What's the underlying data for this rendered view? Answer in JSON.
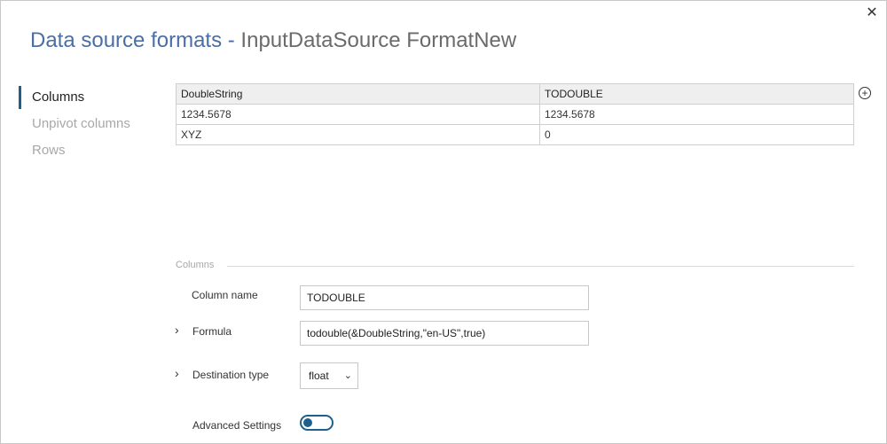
{
  "dialog": {
    "title_main": "Data source formats",
    "title_separator": " - ",
    "title_sub": "InputDataSource FormatNew",
    "close_icon": "✕"
  },
  "nav": {
    "items": [
      {
        "label": "Columns",
        "active": true
      },
      {
        "label": "Unpivot columns",
        "active": false
      },
      {
        "label": "Rows",
        "active": false
      }
    ]
  },
  "grid": {
    "columns": [
      "DoubleString",
      "TODOUBLE"
    ],
    "rows": [
      [
        "1234.5678",
        "1234.5678"
      ],
      [
        "XYZ",
        "0"
      ]
    ],
    "add_icon": "+"
  },
  "columns_section": {
    "header": "Columns",
    "column_name_label": "Column name",
    "column_name_value": "TODOUBLE",
    "formula_label": "Formula",
    "formula_value": "todouble(&DoubleString,\"en-US\",true)",
    "destination_type_label": "Destination type",
    "destination_type_value": "float",
    "advanced_settings_label": "Advanced Settings",
    "advanced_settings_on": false
  },
  "icons": {
    "chevron_right": "›",
    "caret_down": "⌄"
  },
  "colors": {
    "accent": "#1f5f8b",
    "title": "#4a6fa5"
  }
}
